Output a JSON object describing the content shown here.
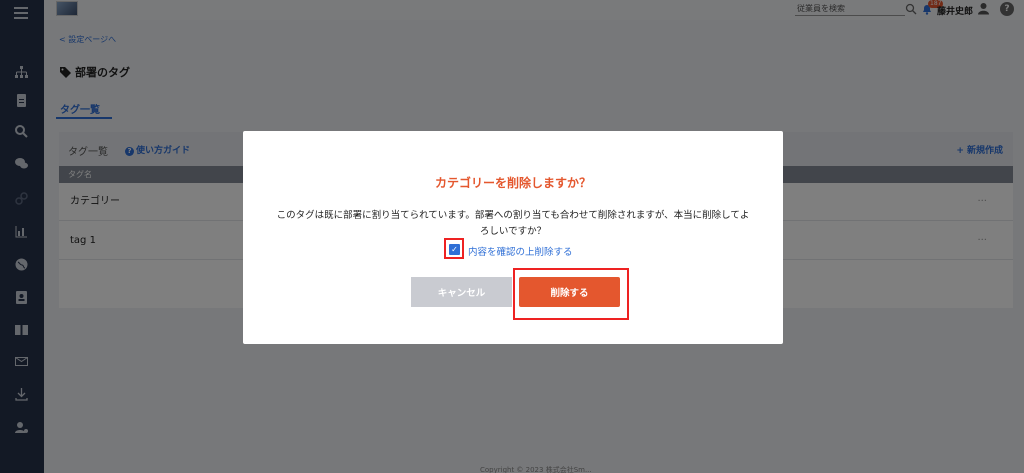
{
  "header": {
    "search_placeholder": "従業員を検索",
    "notification_count": "187",
    "user_name": "藤井史郎",
    "help": "?"
  },
  "page": {
    "back_link": "< 設定ページへ",
    "title": "部署のタグ",
    "tab_label": "タグ一覧"
  },
  "panel": {
    "heading": "タグ一覧",
    "guide_link": "使い方ガイド",
    "new_button": "+ 新規作成",
    "column_header": "タグ名",
    "rows": [
      {
        "name": "カテゴリー",
        "menu": "···"
      },
      {
        "name": "tag 1",
        "menu": "···"
      }
    ]
  },
  "footer": {
    "text": "Copyright © 2023 株式会社Sm..."
  },
  "modal": {
    "title": "カテゴリーを削除しますか？",
    "message": "このタグは既に部署に割り当てられています。部署への割り当ても合わせて削除されますが、本当に削除してよろしいですか？",
    "confirm_checked": true,
    "confirm_label": "内容を確認の上削除する",
    "cancel_label": "キャンセル",
    "delete_label": "削除する"
  },
  "colors": {
    "sidebar": "#26324a",
    "accent": "#2f6fd6",
    "danger": "#e4572e"
  },
  "sidebar_icons": [
    "menu-icon",
    "org-chart-icon",
    "document-icon",
    "search-icon",
    "chat-icon",
    "link-icon",
    "chart-icon",
    "globe-icon",
    "id-card-icon",
    "book-icon",
    "mail-icon",
    "download-icon",
    "user-settings-icon"
  ]
}
